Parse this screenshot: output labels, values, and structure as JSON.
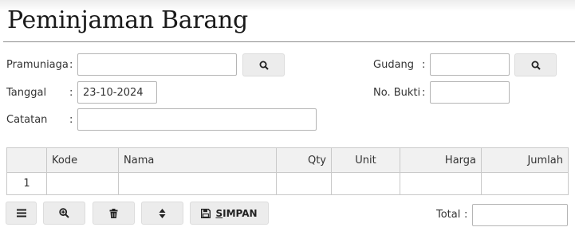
{
  "page": {
    "title": "Peminjaman Barang"
  },
  "form": {
    "pramuniaga": {
      "label": "Pramuniaga",
      "colon": ":",
      "value": ""
    },
    "tanggal": {
      "label": "Tanggal",
      "colon": ":",
      "value": "23-10-2024"
    },
    "catatan": {
      "label": "Catatan",
      "colon": ":",
      "value": ""
    },
    "gudang": {
      "label": "Gudang",
      "colon": ":",
      "value": ""
    },
    "no_bukti": {
      "label": "No. Bukti",
      "colon": ":",
      "value": ""
    }
  },
  "icons": {
    "search": "search-icon",
    "menu": "menu-icon",
    "zoom": "zoom-in-icon",
    "delete": "trash-icon",
    "sort": "sort-icon",
    "save": "floppy-disk-icon"
  },
  "table": {
    "columns": [
      "",
      "Kode",
      "Nama",
      "Qty",
      "Unit",
      "Harga",
      "Jumlah"
    ],
    "rows": [
      [
        "1",
        "",
        "",
        "",
        "",
        "",
        ""
      ]
    ]
  },
  "toolbar": {
    "save_first": "S",
    "save_rest": "IMPAN"
  },
  "total": {
    "label": "Total",
    "colon": ":",
    "value": ""
  },
  "colors": {
    "button_bg": "#ececec",
    "header_bg": "#f1f1f1",
    "border": "#c9c9c9"
  }
}
